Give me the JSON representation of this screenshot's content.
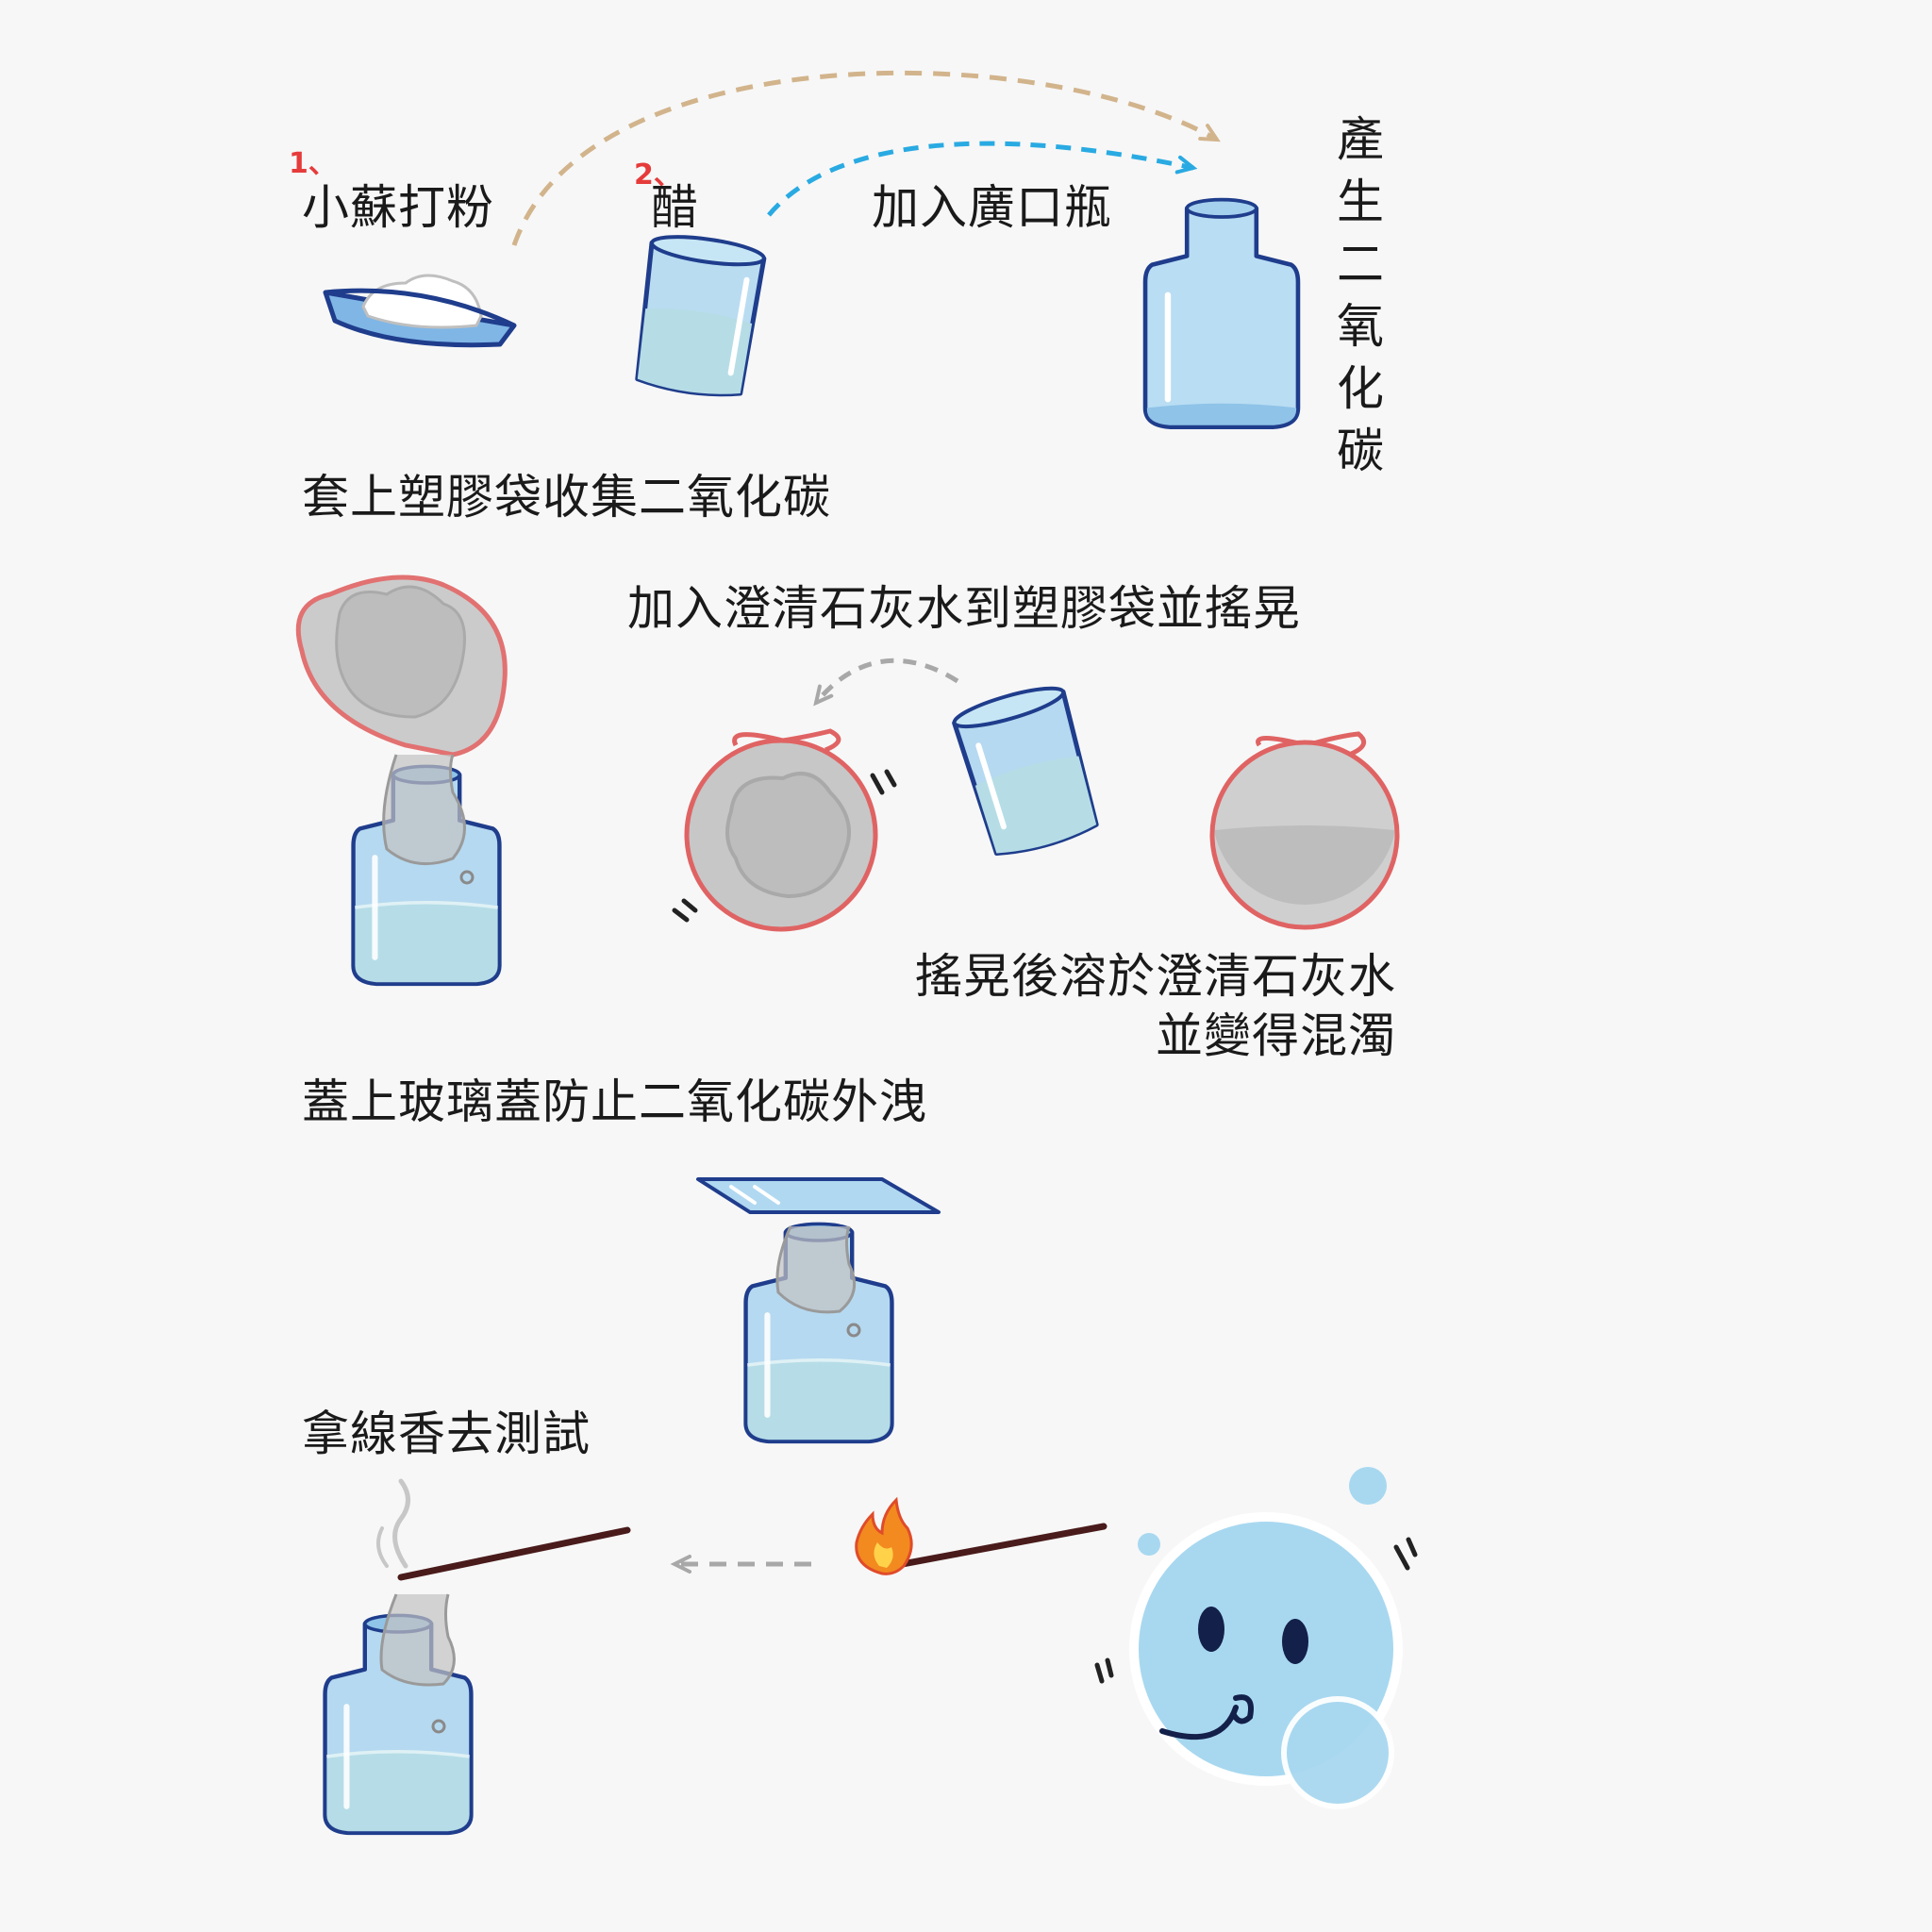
{
  "steps": {
    "s1_num": "1、",
    "s1_label": "小蘇打粉",
    "s2_num": "2、",
    "s2_label": "醋",
    "add_bottle": "加入廣口瓶",
    "produce_co2": "產生二氧化碳",
    "bag_collect": "套上塑膠袋收集二氧化碳",
    "add_limewater": "加入澄清石灰水到塑膠袋並搖晃",
    "result_line1": "搖晃後溶於澄清石灰水",
    "result_line2": "並變得混濁",
    "cover_glass": "蓋上玻璃蓋防止二氧化碳外洩",
    "incense_test": "拿線香去測試"
  },
  "colors": {
    "glass_fill": "#a9d4ef",
    "glass_stroke": "#1f3d8c",
    "liquid": "#b6dde6",
    "bag_stroke": "#e06363",
    "smoke": "#c7c7c7",
    "arrow_tan": "#d2b48c",
    "arrow_blue": "#29aae2",
    "arrow_gray": "#a8a8a8",
    "mascot": "#a8d8f0"
  },
  "icons": [
    "dish-icon",
    "beaker-icon",
    "bottle-icon",
    "bag-icon",
    "glass-cover-icon",
    "incense-icon",
    "flame-icon",
    "mascot-icon"
  ]
}
